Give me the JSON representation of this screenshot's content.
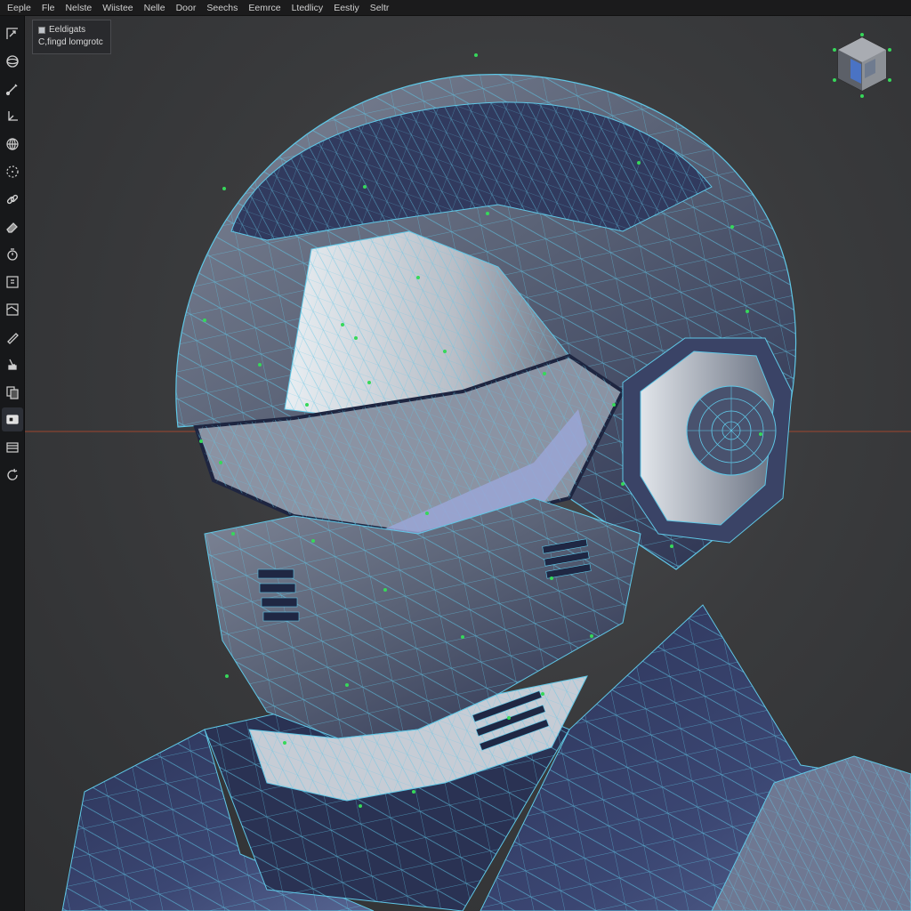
{
  "menu": {
    "items": [
      {
        "label": "Eeple"
      },
      {
        "label": "Fle"
      },
      {
        "label": "Nelste"
      },
      {
        "label": "Wiistee"
      },
      {
        "label": "Nelle"
      },
      {
        "label": "Door"
      },
      {
        "label": "Seechs"
      },
      {
        "label": "Eemrce"
      },
      {
        "label": "Ltedlicy"
      },
      {
        "label": "Eestiy"
      },
      {
        "label": "Seltr"
      }
    ]
  },
  "overlay": {
    "title": "Eeldigats",
    "subtitle": "C,fingd lomgrotc"
  },
  "toolbar": {
    "tools": [
      {
        "icon": "move-icon"
      },
      {
        "icon": "view-sphere-icon"
      },
      {
        "icon": "brush-icon"
      },
      {
        "icon": "axis-icon"
      },
      {
        "icon": "globe-icon"
      },
      {
        "icon": "circle-dots-icon"
      },
      {
        "icon": "link-icon"
      },
      {
        "icon": "eraser-icon"
      },
      {
        "icon": "timer-icon"
      },
      {
        "icon": "grid-select-icon"
      },
      {
        "icon": "frame-icon"
      },
      {
        "icon": "knife-icon"
      },
      {
        "icon": "paint-icon"
      },
      {
        "icon": "copy-icon"
      },
      {
        "icon": "display-icon"
      },
      {
        "icon": "layers-icon"
      },
      {
        "icon": "refresh-icon"
      }
    ],
    "active_index": 14
  },
  "colors": {
    "wire": "#5fc7e6",
    "vertex": "#36d85a",
    "shell_dark": "#27304f",
    "shell_light": "#c9ced4",
    "horizon_line": "#b8492c"
  }
}
